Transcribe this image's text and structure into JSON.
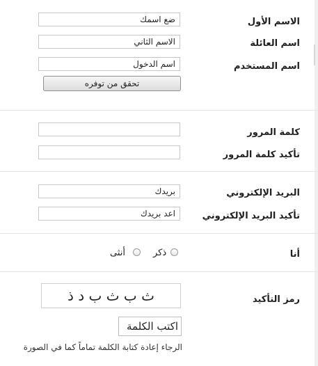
{
  "form": {
    "first_name": {
      "label": "الاسم الأول",
      "placeholder": "ضع اسمك"
    },
    "last_name": {
      "label": "اسم العائلة",
      "placeholder": "الاسم الثاني"
    },
    "username": {
      "label": "اسم المستخدم",
      "placeholder": "اسم الدخول"
    },
    "check_button": "تحقق من توفره",
    "password": {
      "label": "كلمة المرور",
      "placeholder": ""
    },
    "confirm_password": {
      "label": "تأكيد كلمة المرور",
      "placeholder": ""
    },
    "email": {
      "label": "البريد الإلكتروني",
      "placeholder": "بريدك"
    },
    "confirm_email": {
      "label": "تأكيد البريد الإلكتروني",
      "placeholder": "اعد بريدك"
    },
    "gender": {
      "label": "أنا",
      "options": [
        "ذكر",
        "أنثى"
      ]
    },
    "captcha": {
      "label": "رمز التأكيد",
      "text": "ث ب ث ب د ذ",
      "placeholder": "اكتب الكلمة",
      "note": "الرجاء إعادة كتابة الكلمة تماماً كما في الصورة"
    }
  }
}
